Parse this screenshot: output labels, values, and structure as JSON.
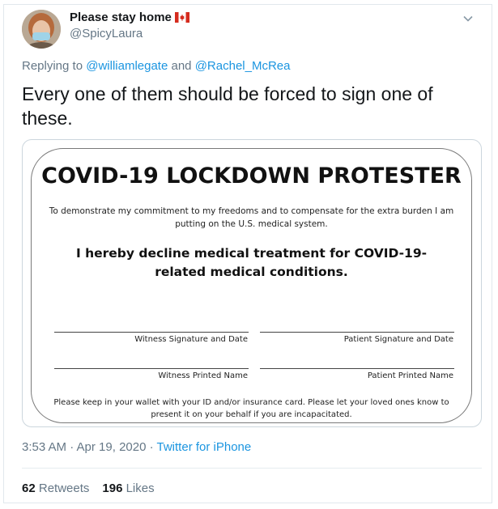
{
  "author": {
    "display_name": "Please stay home",
    "flag_icon": "canada-flag-icon",
    "handle": "@SpicyLaura"
  },
  "reply": {
    "prefix": "Replying to",
    "mention_1": "@williamlegate",
    "conjunction": "and",
    "mention_2": "@Rachel_McRea"
  },
  "tweet": {
    "text": "Every one of them should be forced to sign one of these."
  },
  "card": {
    "title": "COVID-19 LOCKDOWN PROTESTER",
    "intro": "To demonstrate my commitment to my freedoms and to compensate for the extra burden I am putting on the U.S. medical system.",
    "declaration": "I hereby decline medical treatment for COVID-19-related medical conditions.",
    "witness_signature_label": "Witness Signature and Date",
    "patient_signature_label": "Patient Signature and Date",
    "witness_printed_label": "Witness Printed Name",
    "patient_printed_label": "Patient Printed Name",
    "footer": "Please keep in your wallet with your ID and/or insurance card.  Please let your loved ones know to present it on your behalf if you are incapacitated."
  },
  "meta": {
    "time_date": "3:53 AM · Apr 19, 2020 ·",
    "source": "Twitter for iPhone"
  },
  "stats": {
    "retweets_count": "62",
    "retweets_label": "Retweets",
    "likes_count": "196",
    "likes_label": "Likes"
  },
  "colors": {
    "link": "#1b95e0",
    "secondary_text": "#657786",
    "primary_text": "#14171a",
    "border": "#e1e8ed"
  }
}
